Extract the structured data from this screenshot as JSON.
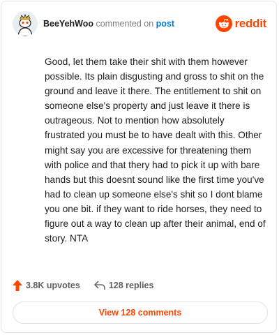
{
  "header": {
    "author": "BeeYehWoo",
    "commented_on": "commented on",
    "post_link": "post",
    "logo_text": "reddit"
  },
  "comment": {
    "text": "Good, let them take their shit with them however possible. Its plain disgusting and gross to shit on the ground and leave it there. The entitlement to shit on someone else's property and just leave it there is outrageous. Not to mention how absolutely frustrated you must be to have dealt with this. Other might say you are excessive for threatening them with police and that thery had to pick it up with bare hands but this doesnt sound like the first time you've had to clean up someone else's shit so I dont blame you one bit. if they want to ride horses, they need to figure out a way to clean up after their animal, end of story. NTA"
  },
  "footer": {
    "upvotes": "3.8K upvotes",
    "replies": "128 replies"
  },
  "view_comments": "View 128 comments",
  "colors": {
    "brand": "#ff4500",
    "link": "#0079d3"
  },
  "icons": [
    "avatar-icon",
    "reddit-logo-icon",
    "upvote-arrow-icon",
    "reply-arrow-icon"
  ]
}
